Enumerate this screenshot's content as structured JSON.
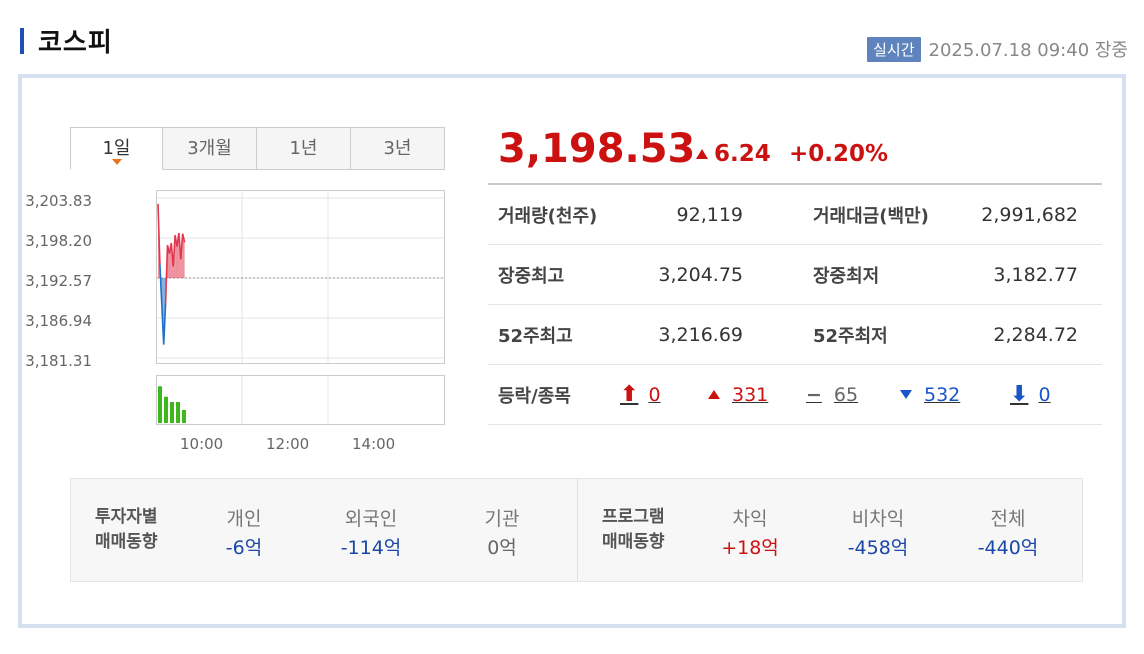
{
  "header": {
    "title": "코스피",
    "live_badge": "실시간",
    "timestamp": "2025.07.18 09:40 장중"
  },
  "tabs": [
    {
      "label": "1일",
      "active": true
    },
    {
      "label": "3개월",
      "active": false
    },
    {
      "label": "1년",
      "active": false
    },
    {
      "label": "3년",
      "active": false
    }
  ],
  "chart": {
    "y_ticks": [
      "3,203.83",
      "3,198.20",
      "3,192.57",
      "3,186.94",
      "3,181.31"
    ],
    "x_ticks": [
      "10:00",
      "12:00",
      "14:00"
    ],
    "reference_value": 3192.29,
    "colors": {
      "up": "#e0374f",
      "down": "#1e6fc8",
      "volume": "#3cb81c",
      "grid": "#e5e5e5"
    }
  },
  "chart_data": {
    "type": "line",
    "series": [
      {
        "values": [
          3203.0,
          3194.5,
          3188.8,
          3183.2,
          3189.0,
          3197.2,
          3196.0,
          3197.5,
          3194.2,
          3198.6,
          3197.0,
          3198.9,
          3195.2,
          3198.8,
          3197.6
        ]
      }
    ],
    "volume": [
      14,
      10,
      8,
      8,
      5
    ],
    "ylim": [
      3181.31,
      3203.83
    ],
    "baseline": 3192.57
  },
  "quote": {
    "price": "3,198.53",
    "change": "6.24",
    "change_pct": "+0.20%"
  },
  "stats": {
    "volume_label": "거래량(천주)",
    "volume": "92,119",
    "value_label": "거래대금(백만)",
    "value": "2,991,682",
    "high_label": "장중최고",
    "high": "3,204.75",
    "low_label": "장중최저",
    "low": "3,182.77",
    "w52_high_label": "52주최고",
    "w52_high": "3,216.69",
    "w52_low_label": "52주최저",
    "w52_low": "2,284.72"
  },
  "updown": {
    "label": "등락/종목",
    "upper_limit": "0",
    "up": "331",
    "flat": "65",
    "down": "532",
    "lower_limit": "0"
  },
  "investors": {
    "head_line1": "투자자별",
    "head_line2": "매매동향",
    "individual_label": "개인",
    "individual": "-6억",
    "foreign_label": "외국인",
    "foreign": "-114억",
    "institution_label": "기관",
    "institution": "0억"
  },
  "program": {
    "head_line1": "프로그램",
    "head_line2": "매매동향",
    "arbitrage_label": "차익",
    "arbitrage": "+18억",
    "non_arbitrage_label": "비차익",
    "non_arbitrage": "-458억",
    "total_label": "전체",
    "total": "-440억"
  }
}
